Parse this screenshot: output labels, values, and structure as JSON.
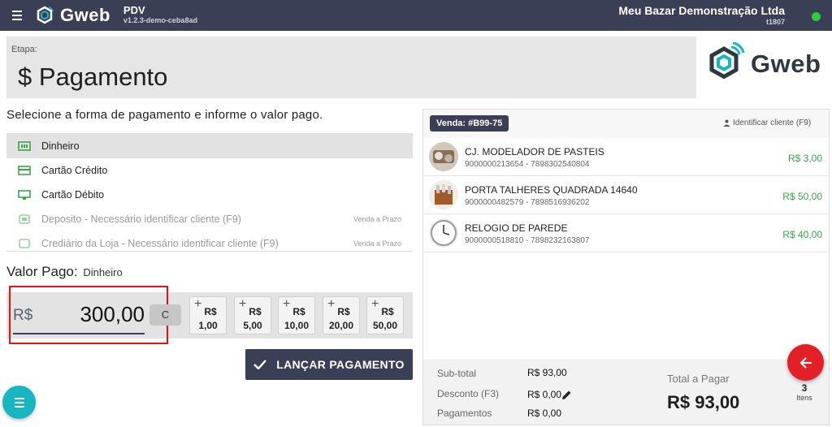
{
  "topbar": {
    "brand": "Gweb",
    "app_name": "PDV",
    "app_version": "v1.2.3-demo-ceba8ad",
    "store_name": "Meu Bazar Demonstração Ltda",
    "store_code": "t1807",
    "status_color": "#2ecc40"
  },
  "step": {
    "label": "Etapa:",
    "title": "$ Pagamento",
    "logo_text": "Gweb"
  },
  "instructions": "Selecione a forma de pagamento e informe o valor pago.",
  "payment_methods": [
    {
      "label": "Dinheiro",
      "icon": "cash-icon",
      "note": "",
      "selected": true
    },
    {
      "label": "Cartão Crédito",
      "icon": "credit-card-icon",
      "note": "",
      "selected": false
    },
    {
      "label": "Cartão Débito",
      "icon": "debit-card-icon",
      "note": "",
      "selected": false
    },
    {
      "label": "Deposito - Necessário identificar cliente (F9)",
      "icon": "deposit-icon",
      "note": "Venda a Prazo",
      "selected": false
    },
    {
      "label": "Crediário da Loja - Necessário identificar cliente (F9)",
      "icon": "store-credit-icon",
      "note": "Venda a Prazo",
      "selected": false
    }
  ],
  "valor_pago": {
    "label": "Valor Pago:",
    "method": "Dinheiro",
    "currency": "R$",
    "amount": "300,00",
    "clear_label": "C"
  },
  "quick_amounts": [
    {
      "currency": "R$",
      "value": "1,00"
    },
    {
      "currency": "R$",
      "value": "5,00"
    },
    {
      "currency": "R$",
      "value": "10,00"
    },
    {
      "currency": "R$",
      "value": "20,00"
    },
    {
      "currency": "R$",
      "value": "50,00"
    }
  ],
  "launch_button": "LANÇAR PAGAMENTO",
  "sale": {
    "badge": "Venda: #B99-75",
    "identify_label": "Identificar cliente (F9)",
    "items": [
      {
        "name": "CJ. MODELADOR DE PASTEIS",
        "code": "9000000213654 - 7898302540804",
        "price": "R$ 3,00"
      },
      {
        "name": "PORTA TALHERES QUADRADA 14640",
        "code": "9000000482579 - 7898516936202",
        "price": "R$ 50,00"
      },
      {
        "name": "RELOGIO DE PAREDE",
        "code": "9000000518810 - 7898232163807",
        "price": "R$ 40,00"
      }
    ],
    "subtotal_label": "Sub-total",
    "subtotal_value": "R$ 93,00",
    "discount_label": "Desconto (F3)",
    "discount_value": "R$ 0,00",
    "payments_label": "Pagamentos",
    "payments_value": "R$ 0,00",
    "total_label": "Total a Pagar",
    "total_value": "R$ 93,00",
    "items_count": "3",
    "items_label": "Itens"
  },
  "colors": {
    "primary": "#3b3f56",
    "accent_teal": "#17b6c1",
    "price_green": "#3ba34a",
    "danger_red": "#e32027"
  }
}
